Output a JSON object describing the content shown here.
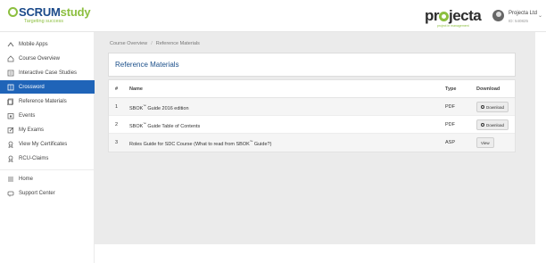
{
  "header": {
    "logo_scrum": "SCRUM",
    "logo_study": "study",
    "logo_tagline": "Targeting success",
    "brand_pre": "pr",
    "brand_post": "jecta",
    "brand_sub": "project in management",
    "user_name": "Projecta Ltd",
    "user_id": "ID: 540825"
  },
  "sidebar": {
    "items": [
      {
        "label": "Mobile Apps",
        "icon": "mobile-icon",
        "active": false
      },
      {
        "label": "Course Overview",
        "icon": "home-outline-icon",
        "active": false
      },
      {
        "label": "Interactive Case Studies",
        "icon": "case-icon",
        "active": false
      },
      {
        "label": "Crossword",
        "icon": "crossword-icon",
        "active": true
      },
      {
        "label": "Reference Materials",
        "icon": "document-icon",
        "active": false
      },
      {
        "label": "Events",
        "icon": "calendar-icon",
        "active": false
      },
      {
        "label": "My Exams",
        "icon": "edit-icon",
        "active": false
      },
      {
        "label": "View My Certificates",
        "icon": "ribbon-icon",
        "active": false
      },
      {
        "label": "RCU-Claims",
        "icon": "ribbon-icon",
        "active": false
      }
    ],
    "bottom_items": [
      {
        "label": "Home",
        "icon": "list-icon"
      },
      {
        "label": "Support Center",
        "icon": "support-icon"
      }
    ]
  },
  "breadcrumb": [
    "Course Overview",
    "Reference Materials"
  ],
  "page_title": "Reference Materials",
  "table": {
    "headers": {
      "num": "#",
      "name": "Name",
      "type": "Type",
      "download": "Download"
    },
    "rows": [
      {
        "num": "1",
        "name_pre": "SBOK",
        "name_sup": "™",
        "name_post": " Guide 2016 edition",
        "type": "PDF",
        "action": "Download"
      },
      {
        "num": "2",
        "name_pre": "SBOK",
        "name_sup": "™",
        "name_post": " Guide Table of Contents",
        "type": "PDF",
        "action": "Download"
      },
      {
        "num": "3",
        "name_pre": "Roles Guide for SDC Course (What to read from SBOK",
        "name_sup": "™",
        "name_post": " Guide?)",
        "type": "ASP",
        "action": "View"
      }
    ]
  },
  "colors": {
    "accent": "#1f64b8",
    "brand_green": "#8cbf3f",
    "title_blue": "#1b4f8a",
    "content_bg": "#ebebeb"
  }
}
